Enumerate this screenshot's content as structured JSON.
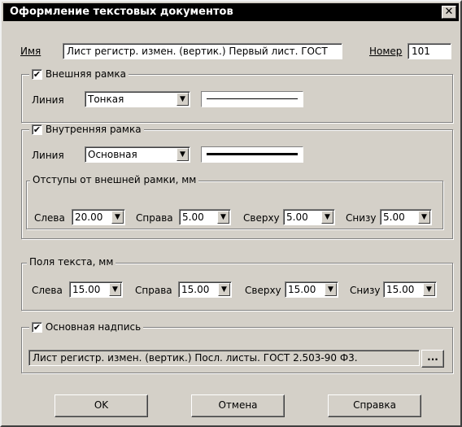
{
  "window": {
    "title": "Оформление текстовых документов",
    "close_glyph": "✕"
  },
  "name": {
    "label": "Имя",
    "value": "Лист регистр. измен. (вертик.) Первый лист. ГОСТ"
  },
  "number": {
    "label": "Номер",
    "value": "101"
  },
  "outer_frame": {
    "title": "Внешняя рамка",
    "checked": true,
    "line_label": "Линия",
    "line_value": "Тонкая"
  },
  "inner_frame": {
    "title": "Внутренняя рамка",
    "checked": true,
    "line_label": "Линия",
    "line_value": "Основная",
    "offsets": {
      "title": "Отступы от внешней рамки, мм",
      "left_label": "Слева",
      "left_value": "20.00",
      "right_label": "Справа",
      "right_value": "5.00",
      "top_label": "Сверху",
      "top_value": "5.00",
      "bottom_label": "Снизу",
      "bottom_value": "5.00"
    }
  },
  "text_margins": {
    "title": "Поля текста, мм",
    "left_label": "Слева",
    "left_value": "15.00",
    "right_label": "Справа",
    "right_value": "15.00",
    "top_label": "Сверху",
    "top_value": "15.00",
    "bottom_label": "Снизу",
    "bottom_value": "15.00"
  },
  "title_block": {
    "title": "Основная надпись",
    "checked": true,
    "value": "Лист регистр. измен. (вертик.) Посл. листы. ГОСТ 2.503-90 Ф3.",
    "browse_label": "..."
  },
  "buttons": {
    "ok": "OK",
    "cancel": "Отмена",
    "help": "Справка"
  },
  "icons": {
    "check": "✔",
    "dropdown": "▼"
  }
}
